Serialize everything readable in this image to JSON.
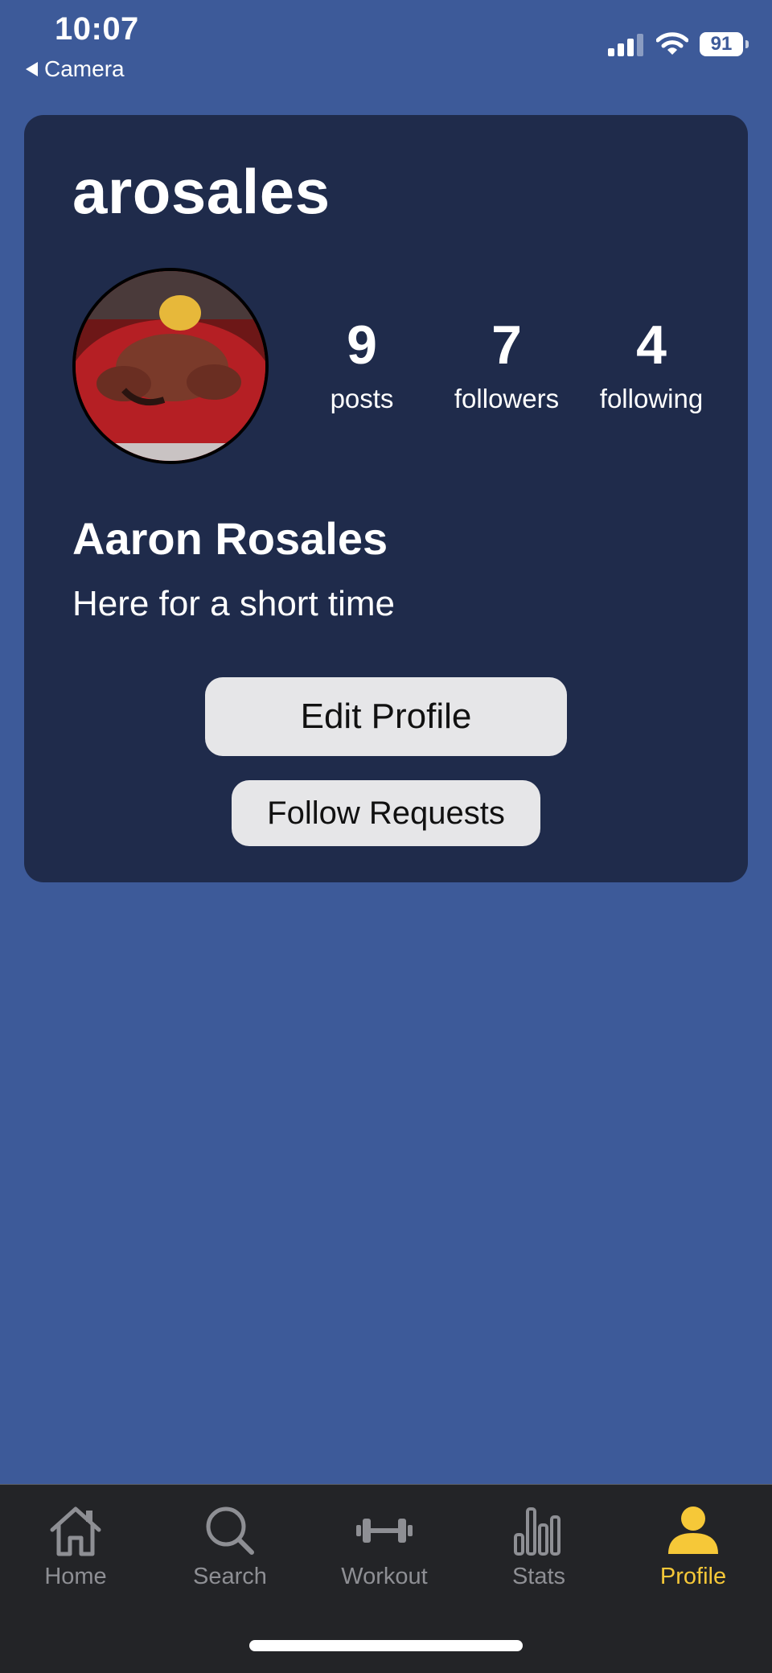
{
  "status_bar": {
    "time": "10:07",
    "back_label": "Camera",
    "battery": "91"
  },
  "profile": {
    "username": "arosales",
    "full_name": "Aaron Rosales",
    "bio": "Here for a short time",
    "stats": [
      {
        "value": "9",
        "label": "posts"
      },
      {
        "value": "7",
        "label": "followers"
      },
      {
        "value": "4",
        "label": "following"
      }
    ],
    "buttons": {
      "edit_profile": "Edit Profile",
      "follow_requests": "Follow Requests"
    }
  },
  "tabbar": {
    "items": [
      {
        "label": "Home",
        "icon": "home-icon"
      },
      {
        "label": "Search",
        "icon": "search-icon"
      },
      {
        "label": "Workout",
        "icon": "dumbbell-icon"
      },
      {
        "label": "Stats",
        "icon": "bar-chart-icon"
      },
      {
        "label": "Profile",
        "icon": "person-icon"
      }
    ],
    "active": "Profile"
  },
  "colors": {
    "background": "#3d5a99",
    "card": "#1f2b4b",
    "button": "#e6e6e8",
    "tabbar": "#232427",
    "tab_inactive": "#8e8f94",
    "tab_active": "#f6c838"
  }
}
